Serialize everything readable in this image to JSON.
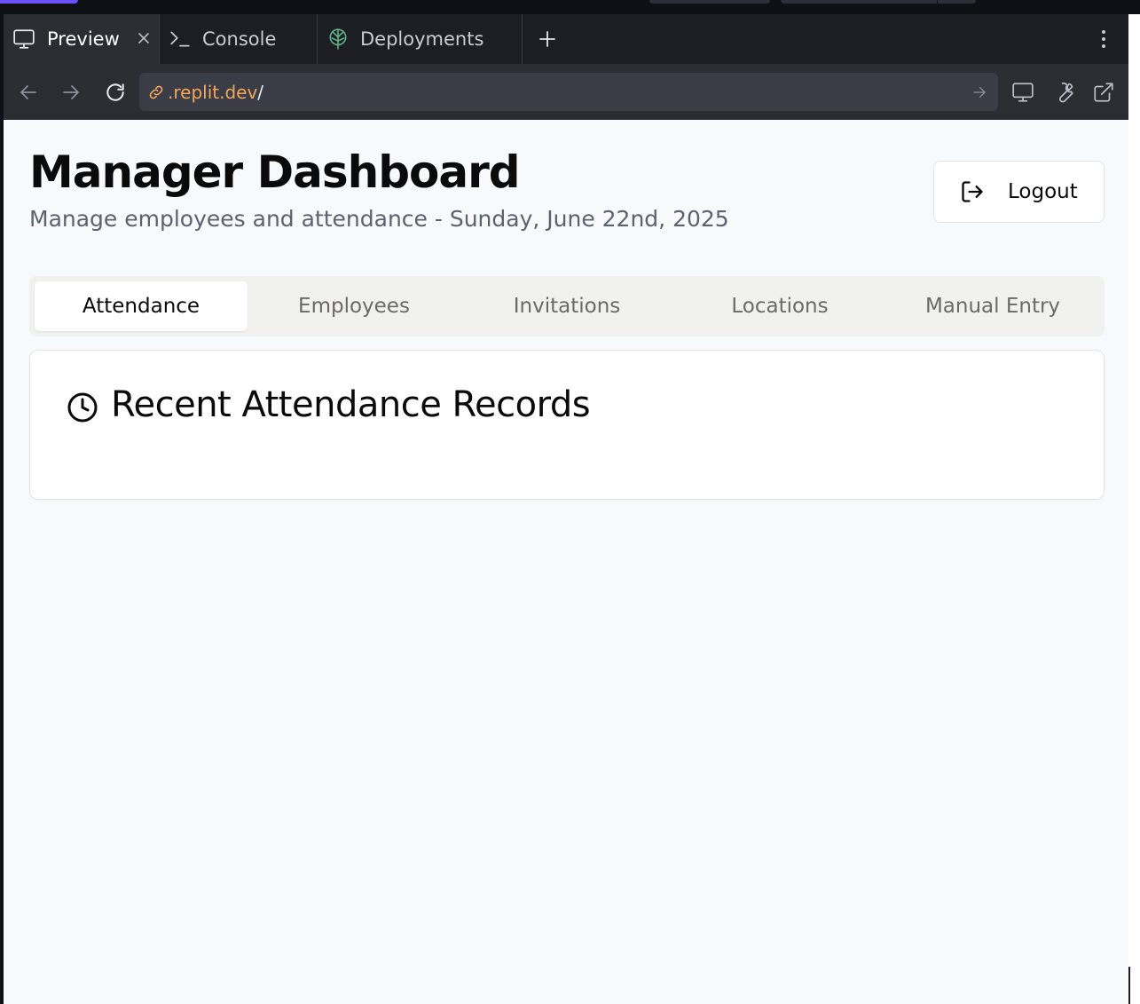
{
  "browser": {
    "tabs": [
      {
        "label": "Preview",
        "icon": "monitor-icon",
        "active": true
      },
      {
        "label": "Console",
        "icon": "terminal-icon",
        "active": false
      },
      {
        "label": "Deployments",
        "icon": "deployments-icon",
        "active": false
      }
    ],
    "new_tab_icon": "plus-icon",
    "menu_icon": "kebab-icon",
    "url_host": ".replit.dev",
    "url_path": "/"
  },
  "header": {
    "title": "Manager Dashboard",
    "subtitle": "Manage employees and attendance - Sunday, June 22nd, 2025",
    "logout_label": "Logout"
  },
  "nav_tabs": [
    {
      "label": "Attendance",
      "active": true
    },
    {
      "label": "Employees",
      "active": false
    },
    {
      "label": "Invitations",
      "active": false
    },
    {
      "label": "Locations",
      "active": false
    },
    {
      "label": "Manual Entry",
      "active": false
    }
  ],
  "card": {
    "heading": "Recent Attendance Records",
    "icon": "clock-icon"
  },
  "colors": {
    "accent": "#6b4ef6",
    "url_host": "#f5a55a",
    "deploy_icon": "#5fb386"
  }
}
